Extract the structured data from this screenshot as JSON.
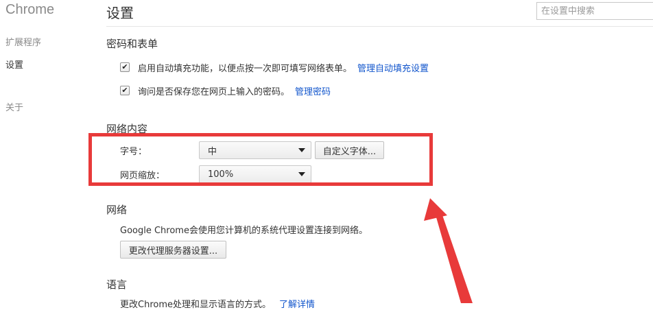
{
  "app": {
    "title": "Chrome"
  },
  "sidebar": {
    "items": [
      {
        "label": "扩展程序",
        "active": false
      },
      {
        "label": "设置",
        "active": true
      },
      {
        "label": "关于",
        "active": false
      }
    ]
  },
  "header": {
    "title": "设置",
    "search_placeholder": "在设置中搜索"
  },
  "passwords": {
    "title": "密码和表单",
    "autofill": {
      "checked": true,
      "text": "启用自动填充功能，以便点按一次即可填写网络表单。",
      "link": "管理自动填充设置"
    },
    "save_passwords": {
      "checked": true,
      "text": "询问是否保存您在网页上输入的密码。",
      "link": "管理密码"
    }
  },
  "web_content": {
    "title": "网络内容",
    "font_size": {
      "label": "字号：",
      "value": "中"
    },
    "custom_fonts_button": "自定义字体...",
    "zoom": {
      "label": "网页缩放：",
      "value": "100%"
    }
  },
  "network": {
    "title": "网络",
    "description": "Google Chrome会使用您计算机的系统代理设置连接到网络。",
    "proxy_button": "更改代理服务器设置..."
  },
  "languages": {
    "title": "语言",
    "description": "更改Chrome处理和显示语言的方式。",
    "link": "了解详情"
  },
  "colors": {
    "annotation": "#e83a3a",
    "link": "#1155cc"
  }
}
